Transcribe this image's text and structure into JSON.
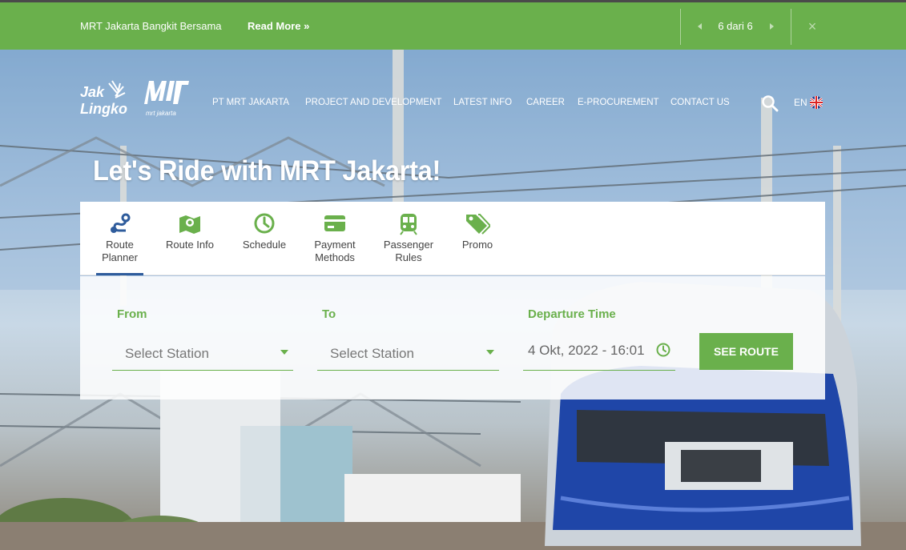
{
  "announcement": {
    "title": "MRT Jakarta Bangkit Bersama",
    "read_more": "Read More »",
    "counter": "6 dari 6",
    "close": "×"
  },
  "brand": {
    "logo1_line1": "Jak",
    "logo1_line2": "Lingko",
    "logo2_caption": "mrt jakarta"
  },
  "nav": {
    "items": [
      "PT MRT JAKARTA",
      "PROJECT AND DEVELOPMENT",
      "LATEST INFO",
      "CAREER",
      "E-PROCUREMENT",
      "CONTACT US"
    ],
    "lang": "EN"
  },
  "hero": {
    "headline": "Let's Ride with MRT Jakarta!"
  },
  "tabs": [
    {
      "label": "Route\nPlanner",
      "icon": "route-icon",
      "active": true
    },
    {
      "label": "Route Info",
      "icon": "map-icon"
    },
    {
      "label": "Schedule",
      "icon": "clock-icon"
    },
    {
      "label": "Payment\nMethods",
      "icon": "card-icon"
    },
    {
      "label": "Passenger\nRules",
      "icon": "train-icon"
    },
    {
      "label": "Promo",
      "icon": "tags-icon"
    }
  ],
  "planner": {
    "from_label": "From",
    "to_label": "To",
    "departure_label": "Departure Time",
    "from_placeholder": "Select Station",
    "to_placeholder": "Select Station",
    "departure_value": "4 Okt, 2022 - 16:01",
    "button": "SEE ROUTE"
  },
  "colors": {
    "green": "#6ab04c",
    "blue": "#2f5c9c"
  }
}
